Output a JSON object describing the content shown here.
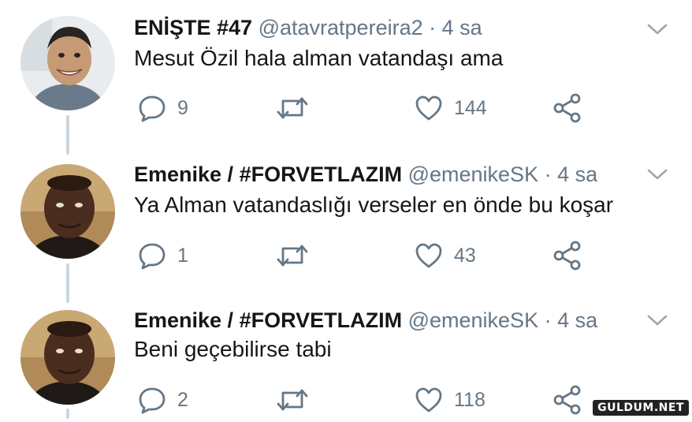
{
  "tweets": [
    {
      "name": "ENİŞTE #47",
      "handle": "@atavratpereira2",
      "separator": "·",
      "time": "4 sa",
      "text": "Mesut Özil hala alman vatandaşı ama",
      "replies": "9",
      "retweets": "",
      "likes": "144",
      "avatar_bg": "#e8ecef",
      "avatar_skin": "#c79a76"
    },
    {
      "name": "Emenike / #FORVETLAZIM",
      "handle": "@emenikeSK",
      "separator": "·",
      "time": "4 sa",
      "text": "Ya Alman vatandaslığı verseler en önde bu koşar",
      "replies": "1",
      "retweets": "",
      "likes": "43",
      "avatar_bg": "#caa874",
      "avatar_skin": "#4a2d1e"
    },
    {
      "name": "Emenike / #FORVETLAZIM",
      "handle": "@emenikeSK",
      "separator": "·",
      "time": "4 sa",
      "text": "Beni geçebilirse tabi",
      "replies": "2",
      "retweets": "",
      "likes": "118",
      "avatar_bg": "#caa874",
      "avatar_skin": "#4a2d1e"
    }
  ],
  "watermark": "GULDUM.NET",
  "colors": {
    "icon": "#657786",
    "thread": "#ccd6dd",
    "name": "#14171a"
  }
}
